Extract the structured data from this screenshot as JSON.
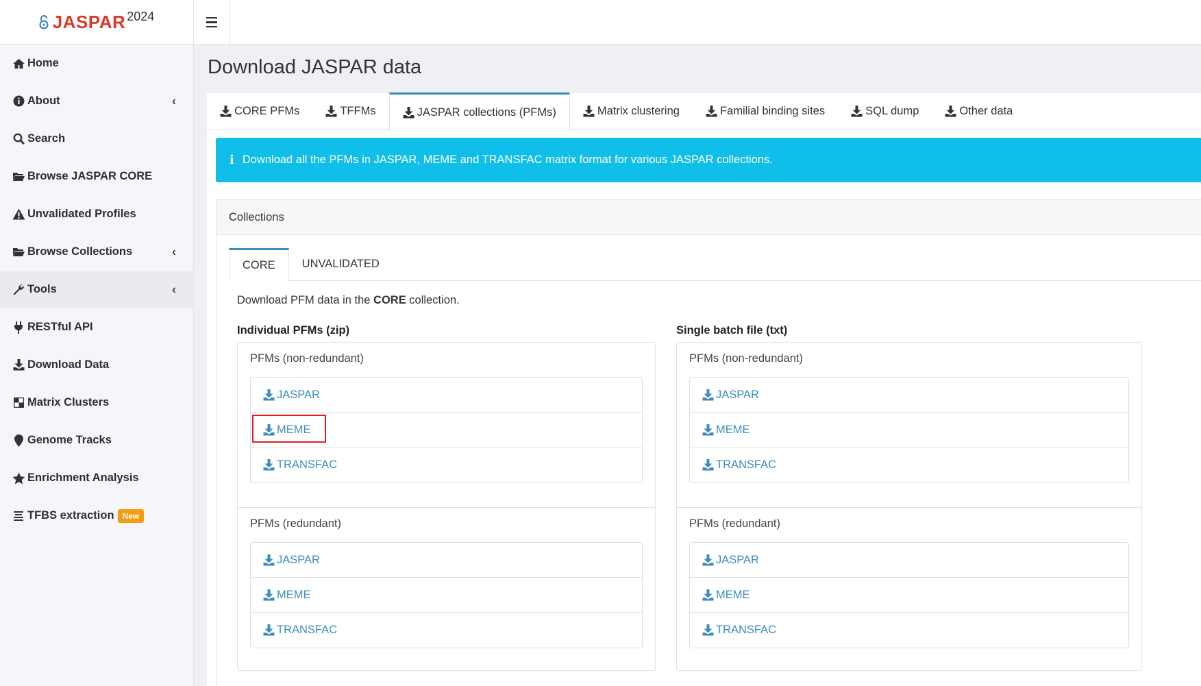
{
  "brand": {
    "name": "JASPAR",
    "year": "2024"
  },
  "sidebar": {
    "items": [
      {
        "label": "Home",
        "icon": "home-icon",
        "chevron": false
      },
      {
        "label": "About",
        "icon": "info-icon",
        "chevron": true
      },
      {
        "label": "Search",
        "icon": "search-icon",
        "chevron": false
      },
      {
        "label": "Browse JASPAR CORE",
        "icon": "folder-open-icon",
        "chevron": false
      },
      {
        "label": "Unvalidated Profiles",
        "icon": "warning-icon",
        "chevron": false
      },
      {
        "label": "Browse Collections",
        "icon": "folder-open-icon",
        "chevron": true
      },
      {
        "label": "Tools",
        "icon": "wrench-icon",
        "chevron": true
      },
      {
        "label": "RESTful API",
        "icon": "plug-icon",
        "chevron": false
      },
      {
        "label": "Download Data",
        "icon": "download-icon",
        "chevron": false
      },
      {
        "label": "Matrix Clusters",
        "icon": "chess-board-icon",
        "chevron": false
      },
      {
        "label": "Genome Tracks",
        "icon": "map-marker-icon",
        "chevron": false
      },
      {
        "label": "Enrichment Analysis",
        "icon": "star-icon",
        "chevron": false
      },
      {
        "label": "TFBS extraction",
        "icon": "align-icon",
        "chevron": false,
        "badge": "New"
      }
    ]
  },
  "page": {
    "title": "Download JASPAR data"
  },
  "tabs": [
    {
      "label": "CORE PFMs"
    },
    {
      "label": "TFFMs"
    },
    {
      "label": "JASPAR collections (PFMs)"
    },
    {
      "label": "Matrix clustering"
    },
    {
      "label": "Familial binding sites"
    },
    {
      "label": "SQL dump"
    },
    {
      "label": "Other data"
    }
  ],
  "alert": {
    "text": "Download all the PFMs in JASPAR, MEME and TRANSFAC matrix format for various JASPAR collections."
  },
  "panel": {
    "title": "Collections",
    "subtabs": [
      {
        "label": "CORE"
      },
      {
        "label": "UNVALIDATED"
      }
    ],
    "intro_pre": "Download PFM data in the ",
    "intro_bold": "CORE",
    "intro_post": " collection.",
    "columns": [
      {
        "title": "Individual PFMs (zip)",
        "sections": [
          {
            "title": "PFMs (non-redundant)",
            "links": [
              "JASPAR",
              "MEME",
              "TRANSFAC"
            ]
          },
          {
            "title": "PFMs (redundant)",
            "links": [
              "JASPAR",
              "MEME",
              "TRANSFAC"
            ]
          }
        ]
      },
      {
        "title": "Single batch file (txt)",
        "sections": [
          {
            "title": "PFMs (non-redundant)",
            "links": [
              "JASPAR",
              "MEME",
              "TRANSFAC"
            ]
          },
          {
            "title": "PFMs (redundant)",
            "links": [
              "JASPAR",
              "MEME",
              "TRANSFAC"
            ]
          }
        ]
      }
    ]
  },
  "colors": {
    "brand_red": "#d93a2b",
    "link_blue": "#3c8dbc",
    "alert_cyan": "#0fbfe9",
    "badge_orange": "#f39c12",
    "highlight_red": "#e02020"
  }
}
